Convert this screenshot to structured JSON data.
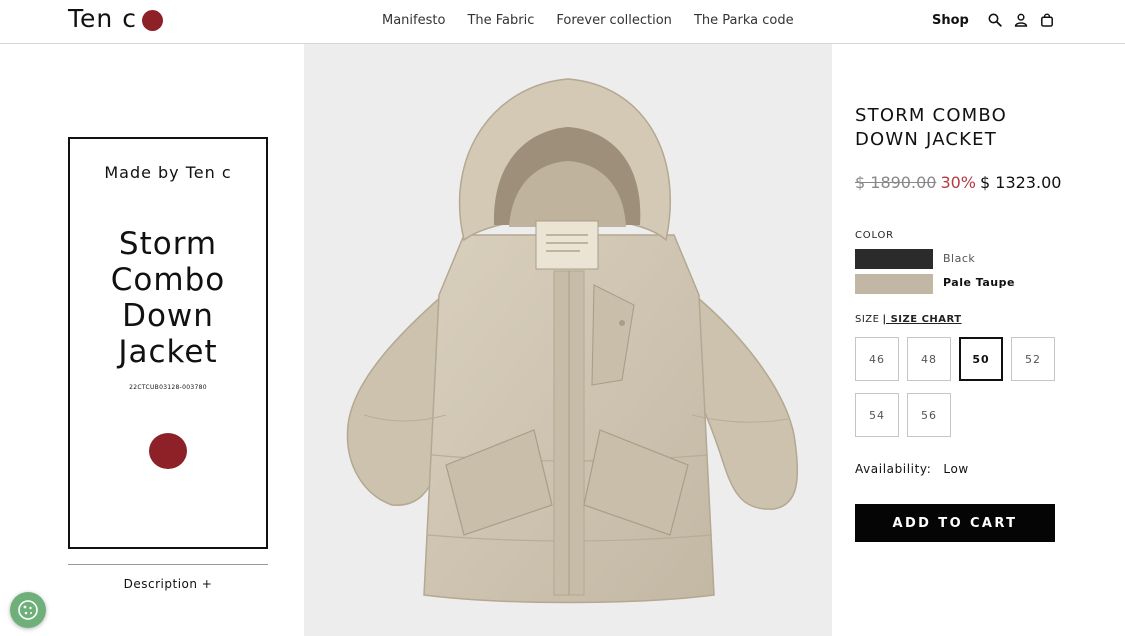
{
  "brand": {
    "logo_text": "Ten c",
    "seal_color": "#8e2028"
  },
  "nav": {
    "items": [
      "Manifesto",
      "The Fabric",
      "Forever collection",
      "The Parka code"
    ],
    "shop": "Shop",
    "icons": [
      "search-icon",
      "account-icon",
      "bag-icon"
    ]
  },
  "label_card": {
    "made_by": "Made by Ten c",
    "title_lines": [
      "Storm",
      "Combo",
      "Down",
      "Jacket"
    ],
    "sku": "22CTCUB03128-003780"
  },
  "description_toggle": "Description  +",
  "product": {
    "title_lines": [
      "STORM COMBO",
      "DOWN JACKET"
    ],
    "old_price": "$ 1890.00",
    "discount": "30%",
    "price": "$ 1323.00",
    "color_label": "COLOR",
    "colors": [
      {
        "name": "Black",
        "swatch": "#2b2b2b",
        "selected": false
      },
      {
        "name": "Pale Taupe",
        "swatch": "#c2b7a4",
        "selected": true
      }
    ],
    "size_label": "SIZE",
    "size_chart": "| SIZE CHART",
    "sizes": [
      "46",
      "48",
      "50",
      "52",
      "54",
      "56"
    ],
    "selected_size": "50",
    "availability_label": "Availability:",
    "availability_value": "Low",
    "add_to_cart": "ADD TO CART"
  },
  "accent_colors": {
    "discount": "#b53a44",
    "cookie": "#6fb07a"
  }
}
